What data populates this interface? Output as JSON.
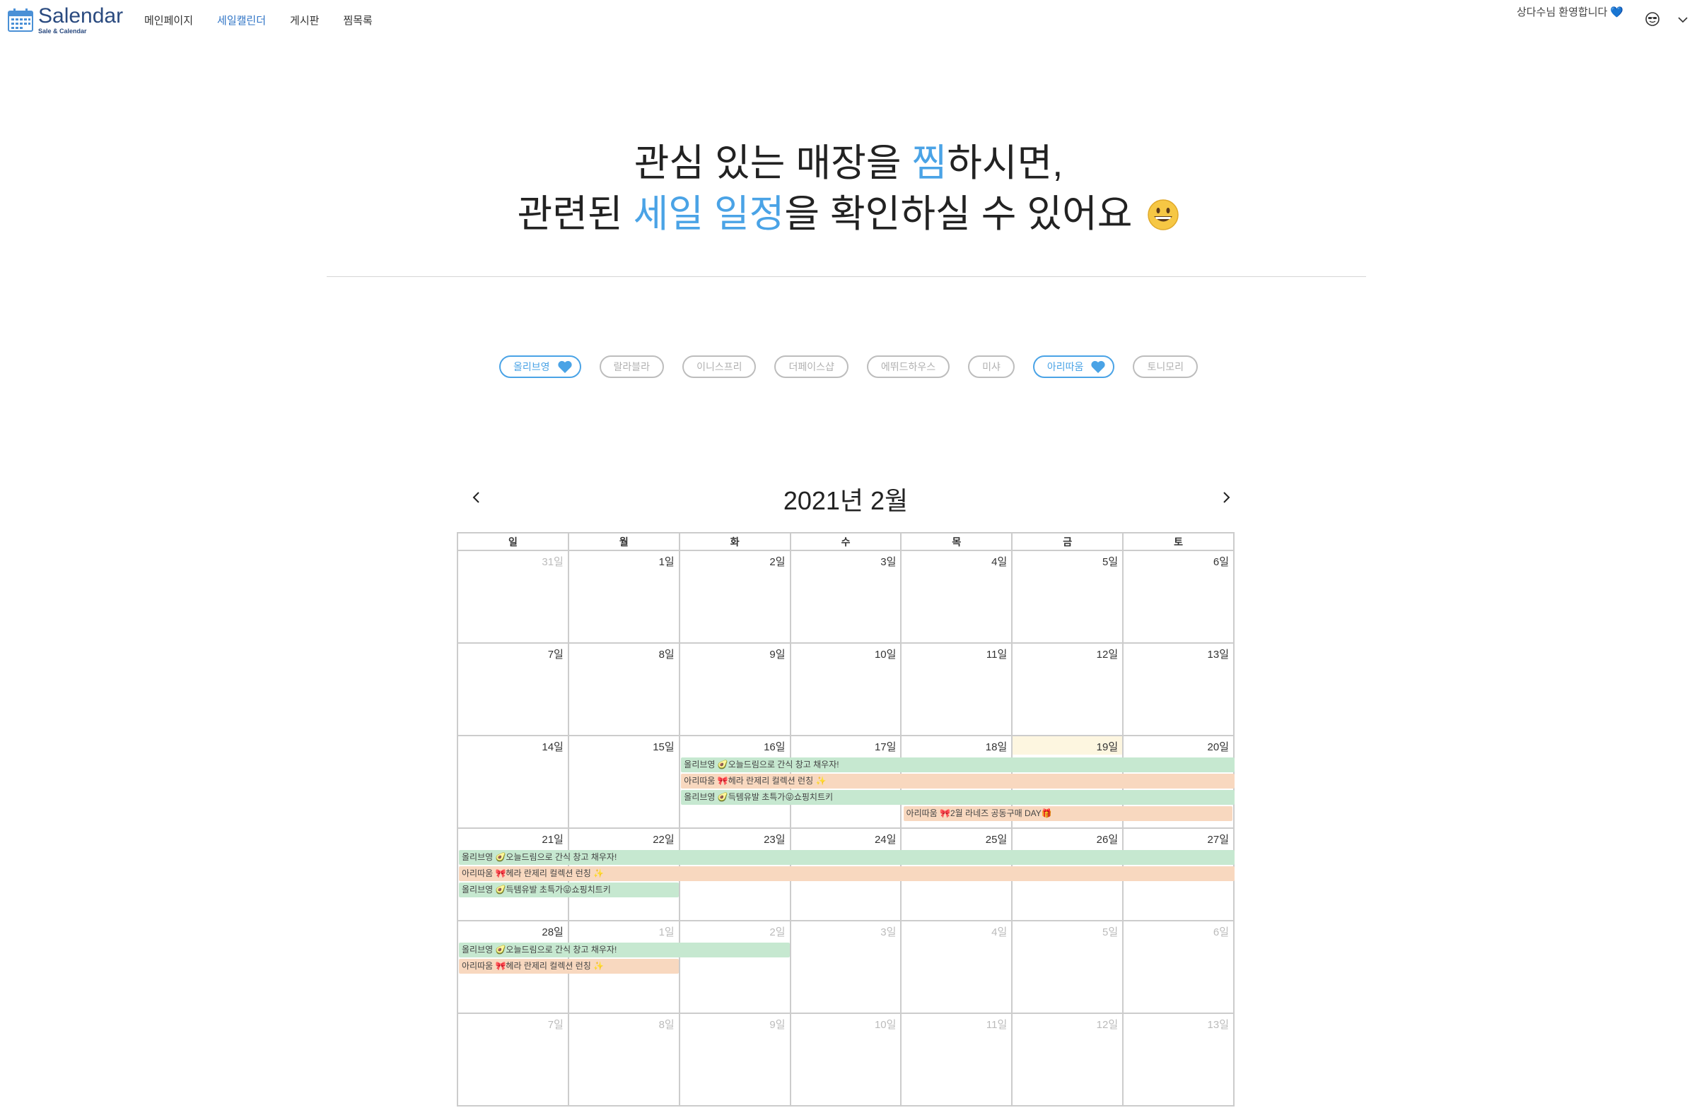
{
  "nav": {
    "logo_title": "Salendar",
    "logo_sub": "Sale & Calendar",
    "menu": [
      "메인페이지",
      "세일캘린더",
      "게시판",
      "찜목록"
    ],
    "welcome": "상다수님 환영합니다",
    "welcome_heart": "💙"
  },
  "hero": {
    "line1_a": "관심 있는 매장을 ",
    "line1_hl": "찜",
    "line1_b": "하시면,",
    "line2_a": "관련된 ",
    "line2_hl": "세일 일정",
    "line2_b": "을 확인하실 수 있어요"
  },
  "chips": [
    {
      "label": "올리브영",
      "on": true
    },
    {
      "label": "랄라블라",
      "on": false
    },
    {
      "label": "이니스프리",
      "on": false
    },
    {
      "label": "더페이스샵",
      "on": false
    },
    {
      "label": "에뛰드하우스",
      "on": false
    },
    {
      "label": "미샤",
      "on": false
    },
    {
      "label": "아리따움",
      "on": true
    },
    {
      "label": "토니모리",
      "on": false
    }
  ],
  "calendar": {
    "title": "2021년 2월",
    "weekdays": [
      "일",
      "월",
      "화",
      "수",
      "목",
      "금",
      "토"
    ],
    "weeks": [
      [
        "31일",
        "1일",
        "2일",
        "3일",
        "4일",
        "5일",
        "6일"
      ],
      [
        "7일",
        "8일",
        "9일",
        "10일",
        "11일",
        "12일",
        "13일"
      ],
      [
        "14일",
        "15일",
        "16일",
        "17일",
        "18일",
        "19일",
        "20일"
      ],
      [
        "21일",
        "22일",
        "23일",
        "24일",
        "25일",
        "26일",
        "27일"
      ],
      [
        "28일",
        "1일",
        "2일",
        "3일",
        "4일",
        "5일",
        "6일"
      ],
      [
        "7일",
        "8일",
        "9일",
        "10일",
        "11일",
        "12일",
        "13일"
      ]
    ],
    "other_month": [
      [
        0
      ],
      [],
      [],
      [],
      [
        1,
        2,
        3,
        4,
        5,
        6
      ],
      [
        0,
        1,
        2,
        3,
        4,
        5,
        6
      ]
    ],
    "today": [
      2,
      5
    ],
    "events": [
      {
        "week": 2,
        "start": 2,
        "end": 6,
        "row": 0,
        "color": "green",
        "text": "올리브영 🥑오늘드림으로 간식 창고 채우자!"
      },
      {
        "week": 2,
        "start": 2,
        "end": 6,
        "row": 1,
        "color": "orange",
        "text": "아리따움 🎀헤라 란제리 컬렉션 런칭 ✨"
      },
      {
        "week": 2,
        "start": 2,
        "end": 6,
        "row": 2,
        "color": "green",
        "text": "올리브영 🥑득템유발 초특가😜쇼핑치트키"
      },
      {
        "week": 2,
        "start": 4,
        "end": 6,
        "row": 3,
        "color": "orange",
        "text": "아리따움 🎀2월 라네즈 공동구매 DAY🎁"
      },
      {
        "week": 3,
        "start": 0,
        "end": 6,
        "row": 0,
        "color": "green",
        "text": "올리브영 🥑오늘드림으로 간식 창고 채우자!"
      },
      {
        "week": 3,
        "start": 0,
        "end": 6,
        "row": 1,
        "color": "orange",
        "text": "아리따움 🎀헤라 란제리 컬렉션 런칭 ✨"
      },
      {
        "week": 3,
        "start": 0,
        "end": 1,
        "row": 2,
        "color": "green",
        "text": "올리브영 🥑득템유발 초특가😜쇼핑치트키"
      },
      {
        "week": 4,
        "start": 0,
        "end": 2,
        "row": 0,
        "color": "green",
        "text": "올리브영 🥑오늘드림으로 간식 창고 채우자!"
      },
      {
        "week": 4,
        "start": 0,
        "end": 1,
        "row": 1,
        "color": "orange",
        "text": "아리따움 🎀헤라 란제리 컬렉션 런칭 ✨"
      }
    ]
  },
  "colors": {
    "accent": "#4aa3e6",
    "menu_active": "#2f74c6",
    "event_green": "#c6e8d0",
    "event_orange": "#f8d8bf",
    "today_bg": "#fdf6e0"
  }
}
